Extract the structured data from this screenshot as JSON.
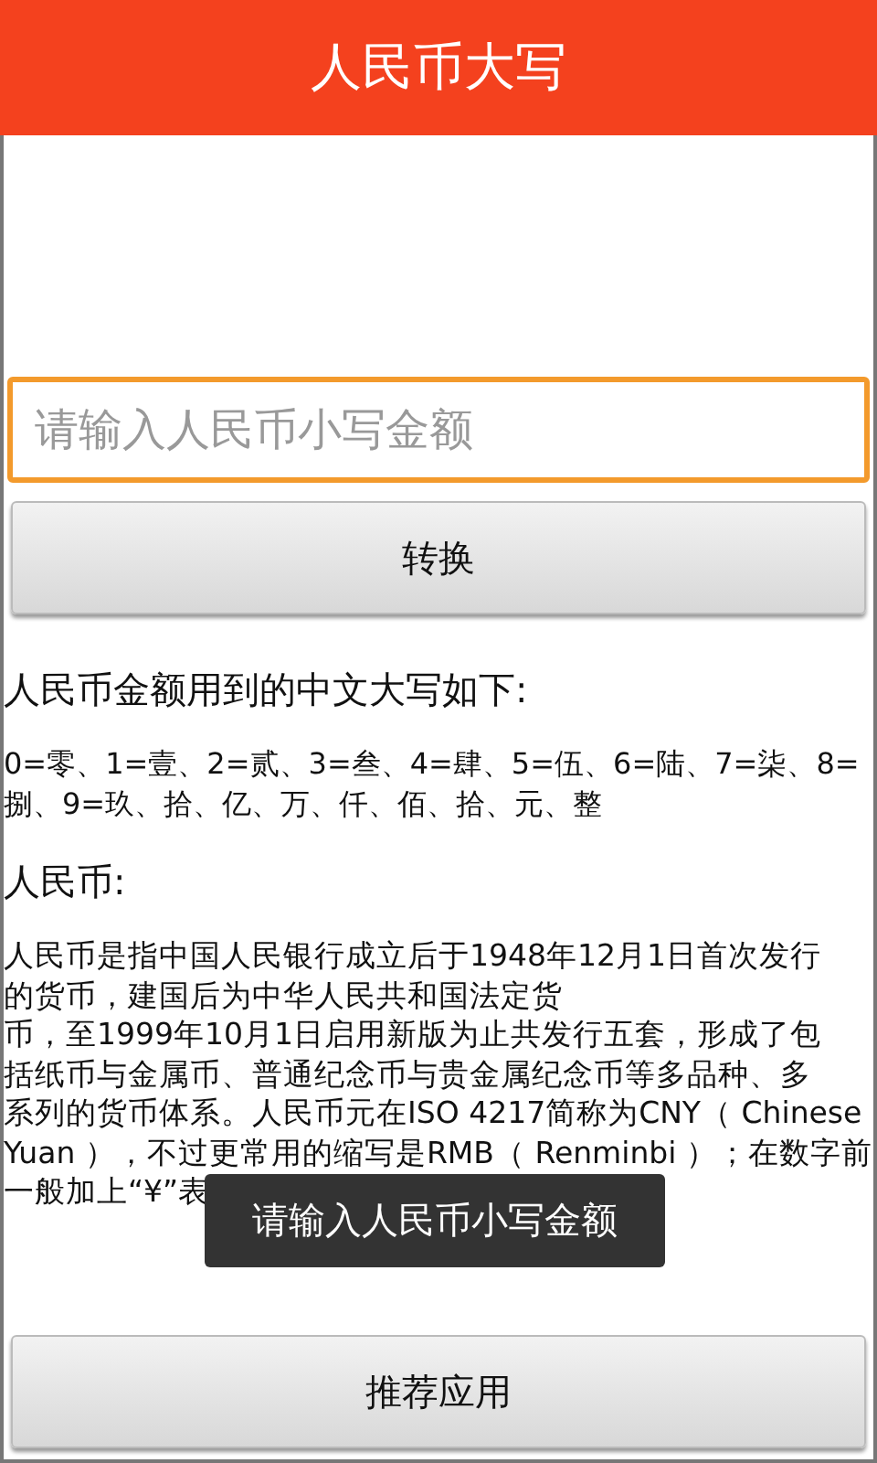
{
  "app_bar": {
    "title": "人民币大写"
  },
  "amount_field": {
    "placeholder": "请输入人民币小写金额"
  },
  "convert_button": "转换",
  "heading": "人民币金额用到的中文大写如下:",
  "numerals": "0=零、1=壹、2=贰、3=叁、4=肆、5=伍、6=陆、7=柒、8=\n捌、9=玖、拾、亿、万、仟、佰、拾、元、整",
  "section_title": "人民币:",
  "description_lines": [
    "人民币是指中国人民银行成立后于1948年12月1日首次发行",
    "的货币，建国后为中华人民共和国法定货",
    "币，至1999年10月1日启用新版为止共发行五套，形成了包",
    "括纸币与金属币、普通纪念币与贵金属纪念币等多品种、多",
    "系列的货币体系。人民币元在ISO 4217简称为CNY（ Chinese",
    "Yuan ），不过更常用的缩写是RMB（ Renminbi ）；在数字前",
    "一般加上“¥”表"
  ],
  "toast": "请输入人民币小写金额",
  "recommend_button": "推荐应用"
}
